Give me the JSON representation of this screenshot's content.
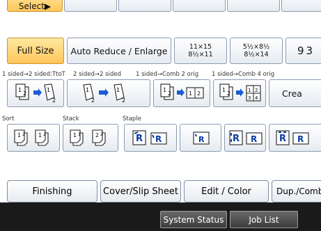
{
  "top": {
    "select_label": "Select▶"
  },
  "reduce": {
    "full_size": "Full Size",
    "auto": "Auto Reduce / Enlarge",
    "p1": {
      "a": "11×15",
      "b": "8½×11"
    },
    "p2": {
      "a": "5½×8½",
      "b": "8½×14"
    },
    "p3": "93"
  },
  "duplex": {
    "labels": [
      "1 sided→2 sided:TtoT",
      "2 sided→2 sided",
      "1 sided→Comb 2 orig",
      "1 sided→Comb 4 orig"
    ],
    "create": "Crea"
  },
  "finish": {
    "sort": "Sort",
    "stack": "Stack",
    "staple": "Staple"
  },
  "tabs": [
    "Finishing",
    "Cover/Slip Sheet",
    "Edit / Color",
    "Dup./Combin"
  ],
  "status": [
    "System Status",
    "Job List"
  ],
  "colors": {
    "selected": "#ffc65a",
    "arrow": "#1b5bd6",
    "bar": "#1a1a1a"
  }
}
